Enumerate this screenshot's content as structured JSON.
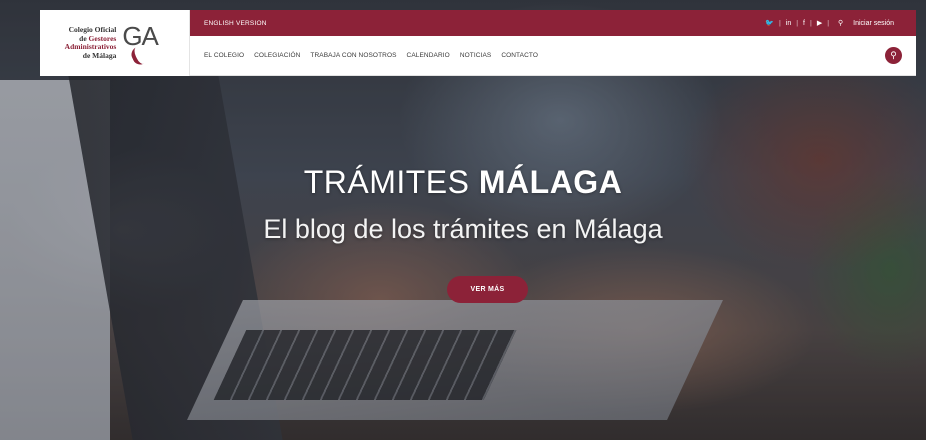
{
  "logo": {
    "line1": "Colegio Oficial",
    "line2_prefix": "de ",
    "line2_highlight": "Gestores",
    "line3": "Administrativos",
    "line4": "de Málaga",
    "mark": "GA"
  },
  "topbar": {
    "english_label": "ENGLISH VERSION",
    "social_icons": [
      "twitter-icon",
      "linkedin-icon",
      "facebook-icon",
      "youtube-icon"
    ],
    "social_glyphs": [
      "🐦",
      "in",
      "f",
      "▶"
    ],
    "login_label": "Iniciar sesión"
  },
  "nav": {
    "items": [
      "EL COLEGIO",
      "COLEGIACIÓN",
      "TRABAJA CON NOSOTROS",
      "CALENDARIO",
      "NOTICIAS",
      "CONTACTO"
    ]
  },
  "hero": {
    "title_light": "TRÁMITES ",
    "title_bold": "MÁLAGA",
    "subtitle": "El blog de los trámites en Málaga",
    "cta_label": "VER MÁS"
  },
  "colors": {
    "accent": "#8c2238",
    "nav_bg": "#ffffff"
  }
}
